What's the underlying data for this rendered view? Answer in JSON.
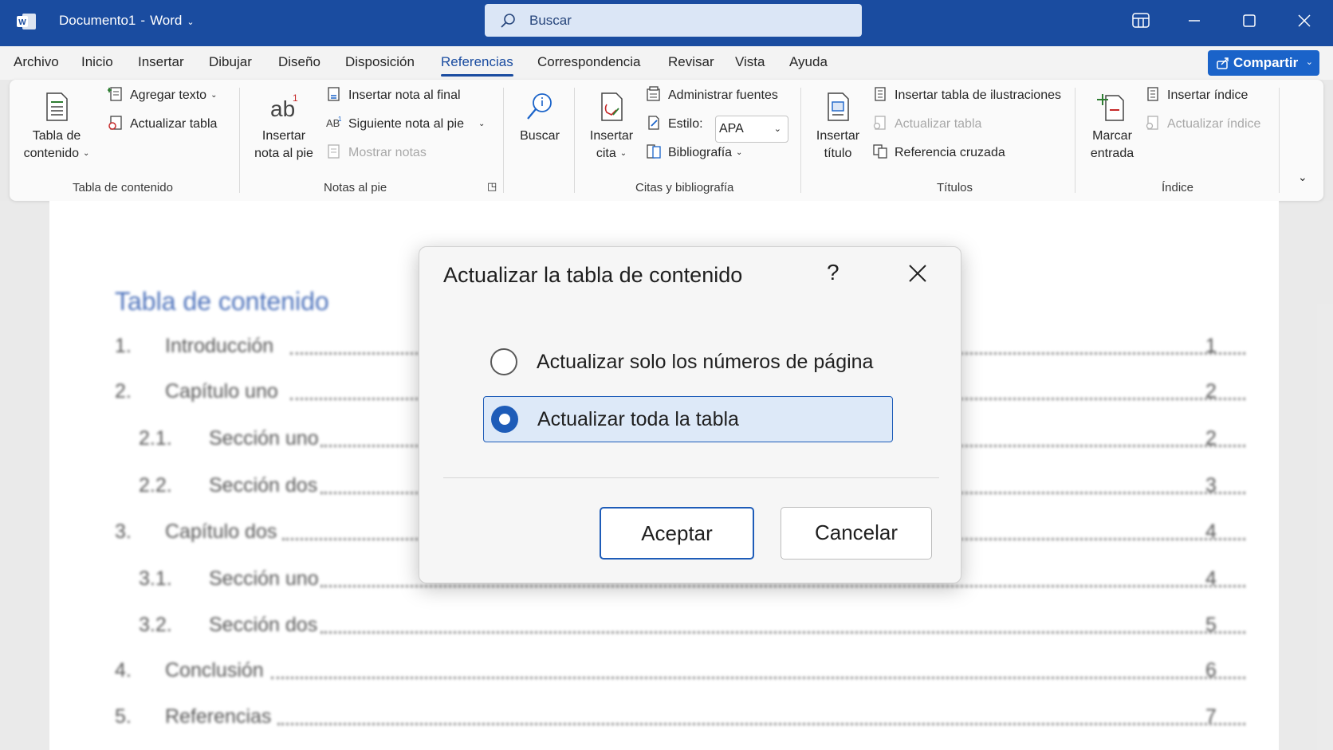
{
  "window": {
    "doc_name": "Documento1",
    "separator": "-",
    "app_name": "Word",
    "search_placeholder": "Buscar"
  },
  "menu": {
    "tabs": [
      "Archivo",
      "Inicio",
      "Insertar",
      "Dibujar",
      "Diseño",
      "Disposición",
      "Referencias",
      "Correspondencia",
      "Revisar",
      "Vista",
      "Ayuda"
    ],
    "active_tab": "Referencias",
    "share_label": "Compartir"
  },
  "ribbon": {
    "toc": {
      "large_label_1": "Tabla de",
      "large_label_2": "contenido",
      "add_text": "Agregar texto",
      "update_table": "Actualizar tabla",
      "group_label": "Tabla de contenido"
    },
    "footnotes": {
      "large_label_1": "Insertar",
      "large_label_2": "nota al pie",
      "insert_endnote": "Insertar nota al final",
      "next_footnote": "Siguiente nota al pie",
      "show_notes": "Mostrar notas",
      "group_label": "Notas al pie"
    },
    "search": {
      "label": "Buscar"
    },
    "citations": {
      "large_label_1": "Insertar",
      "large_label_2": "cita",
      "manage_sources": "Administrar fuentes",
      "style_label": "Estilo:",
      "style_value": "APA",
      "bibliography": "Bibliografía",
      "group_label": "Citas y bibliografía"
    },
    "captions": {
      "large_label_1": "Insertar",
      "large_label_2": "título",
      "insert_table_figures": "Insertar tabla de ilustraciones",
      "update_table": "Actualizar tabla",
      "cross_reference": "Referencia cruzada",
      "group_label": "Títulos"
    },
    "index": {
      "large_label_1": "Marcar",
      "large_label_2": "entrada",
      "insert_index": "Insertar índice",
      "update_index": "Actualizar índice",
      "group_label": "Índice"
    }
  },
  "document": {
    "toc_title": "Tabla de contenido",
    "entries": [
      {
        "num": "1.",
        "text": "Introducción",
        "page": "1"
      },
      {
        "num": "2.",
        "text": "Capítulo uno",
        "page": "2"
      },
      {
        "num": "2.1.",
        "text": "Sección uno",
        "page": "2"
      },
      {
        "num": "2.2.",
        "text": "Sección dos",
        "page": "3"
      },
      {
        "num": "3.",
        "text": "Capítulo dos",
        "page": "4"
      },
      {
        "num": "3.1.",
        "text": "Sección uno",
        "page": "4"
      },
      {
        "num": "3.2.",
        "text": "Sección dos",
        "page": "5"
      },
      {
        "num": "4.",
        "text": "Conclusión",
        "page": "6"
      },
      {
        "num": "5.",
        "text": "Referencias",
        "page": "7"
      }
    ]
  },
  "dialog": {
    "title": "Actualizar la tabla de contenido",
    "help": "?",
    "options": [
      {
        "label": "Actualizar solo los números de página",
        "selected": false
      },
      {
        "label": "Actualizar toda la tabla",
        "selected": true
      }
    ],
    "ok_label": "Aceptar",
    "cancel_label": "Cancelar"
  },
  "colors": {
    "title_bar": "#1a4ca0",
    "accent": "#1e5cb8",
    "toc_title": "#3f67b6"
  },
  "icons": [
    "word-logo-icon",
    "search-icon",
    "ribbon-display-icon",
    "minimize-icon",
    "maximize-icon",
    "close-icon",
    "share-icon",
    "dialog-close-icon"
  ]
}
